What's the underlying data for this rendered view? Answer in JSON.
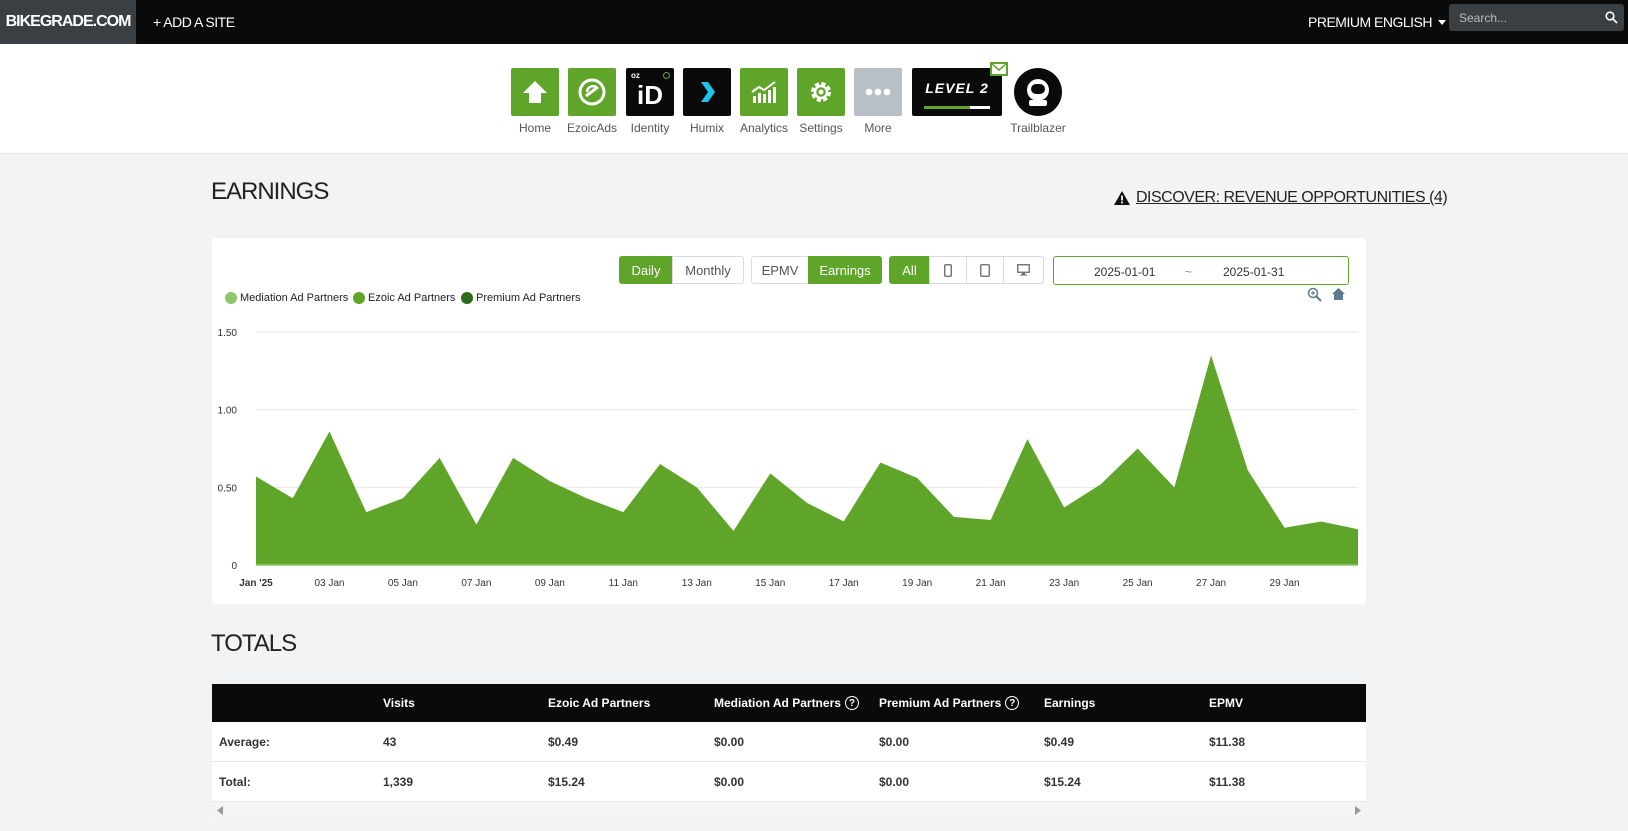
{
  "topbar": {
    "brand": "BIKEGRADE.COM",
    "add_site": "+ ADD A SITE",
    "premium": "PREMIUM",
    "language": "ENGLISH",
    "search_placeholder": "Search..."
  },
  "apps": [
    {
      "label": "Home"
    },
    {
      "label": "EzoicAds"
    },
    {
      "label": "Identity",
      "tile_text": "iD",
      "tile_sub": "oz"
    },
    {
      "label": "Humix"
    },
    {
      "label": "Analytics"
    },
    {
      "label": "Settings"
    },
    {
      "label": "More"
    }
  ],
  "level_badge": "LEVEL 2",
  "level_progress": 0.7,
  "trailblazer": "Trailblazer",
  "earnings": {
    "title": "EARNINGS",
    "discover": "DISCOVER: REVENUE OPPORTUNITIES (4)",
    "period_buttons": [
      "Daily",
      "Monthly"
    ],
    "metric_buttons": [
      "EPMV",
      "Earnings"
    ],
    "device_all": "All",
    "date_from": "2025-01-01",
    "date_sep": "~",
    "date_to": "2025-01-31",
    "legend": [
      {
        "name": "Mediation Ad Partners",
        "color": "#8cc66d"
      },
      {
        "name": "Ezoic Ad Partners",
        "color": "#5fa52a"
      },
      {
        "name": "Premium Ad Partners",
        "color": "#2f6b1a"
      }
    ]
  },
  "chart_data": {
    "type": "area",
    "x": [
      "2025-01-01",
      "2025-01-02",
      "2025-01-03",
      "2025-01-04",
      "2025-01-05",
      "2025-01-06",
      "2025-01-07",
      "2025-01-08",
      "2025-01-09",
      "2025-01-10",
      "2025-01-11",
      "2025-01-12",
      "2025-01-13",
      "2025-01-14",
      "2025-01-15",
      "2025-01-16",
      "2025-01-17",
      "2025-01-18",
      "2025-01-19",
      "2025-01-20",
      "2025-01-21",
      "2025-01-22",
      "2025-01-23",
      "2025-01-24",
      "2025-01-25",
      "2025-01-26",
      "2025-01-27",
      "2025-01-28",
      "2025-01-29",
      "2025-01-30",
      "2025-01-31"
    ],
    "series": [
      {
        "name": "Ezoic Ad Partners",
        "values": [
          0.57,
          0.43,
          0.86,
          0.34,
          0.43,
          0.69,
          0.26,
          0.69,
          0.54,
          0.43,
          0.34,
          0.65,
          0.5,
          0.22,
          0.59,
          0.4,
          0.28,
          0.66,
          0.56,
          0.31,
          0.29,
          0.81,
          0.37,
          0.52,
          0.75,
          0.5,
          1.35,
          0.61,
          0.24,
          0.28,
          0.23
        ]
      }
    ],
    "y_ticks": [
      "0",
      "0.50",
      "1.00",
      "1.50"
    ],
    "x_ticks": [
      "Jan '25",
      "03 Jan",
      "05 Jan",
      "07 Jan",
      "09 Jan",
      "11 Jan",
      "13 Jan",
      "15 Jan",
      "17 Jan",
      "19 Jan",
      "21 Jan",
      "23 Jan",
      "25 Jan",
      "27 Jan",
      "29 Jan"
    ],
    "ylim": [
      0,
      1.5
    ],
    "grid": true,
    "legend_position": "top-left",
    "color": "#5fa52a"
  },
  "totals": {
    "title": "TOTALS",
    "columns": [
      "Visits",
      "Ezoic Ad Partners",
      "Mediation Ad Partners",
      "Premium Ad Partners",
      "Earnings",
      "EPMV"
    ],
    "rows": [
      {
        "label": "Average:",
        "values": [
          "43",
          "$0.49",
          "$0.00",
          "$0.00",
          "$0.49",
          "$11.38"
        ]
      },
      {
        "label": "Total:",
        "values": [
          "1,339",
          "$15.24",
          "$0.00",
          "$0.00",
          "$15.24",
          "$11.38"
        ]
      }
    ]
  }
}
